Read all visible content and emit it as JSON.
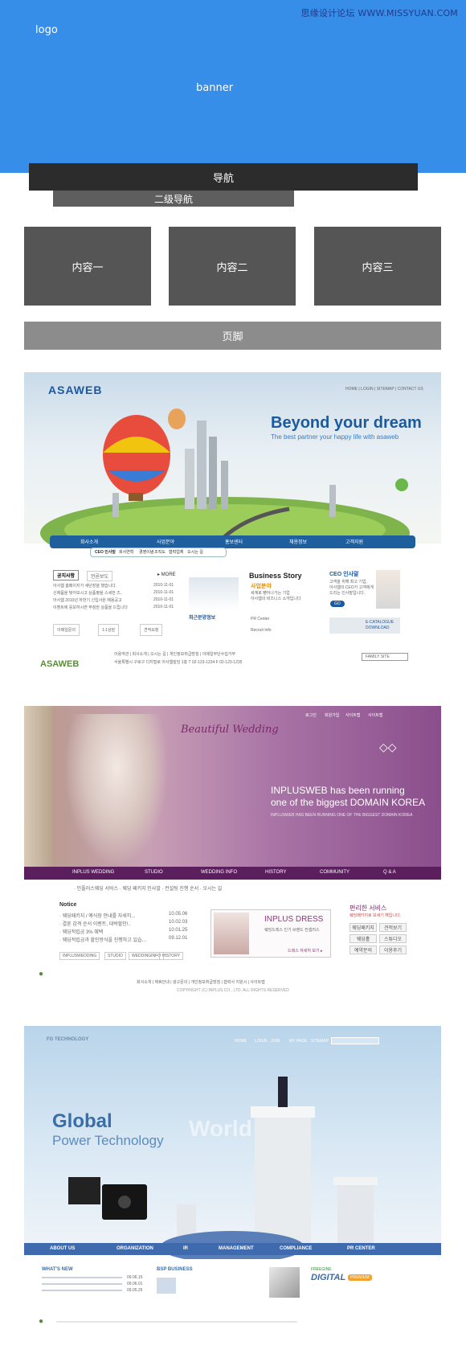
{
  "watermark": "思缘设计论坛 WWW.MISSYUAN.COM",
  "wireframe": {
    "logo": "logo",
    "banner": "banner",
    "nav": "导航",
    "subnav": "二级导航",
    "content": [
      "内容一",
      "内容二",
      "内容三"
    ],
    "footer": "页脚"
  },
  "example1": {
    "brand": "ASAWEB",
    "top_links": "HOME | LOGIN | SITEMAP | CONTACT US",
    "headline": "Beyond your dream",
    "subheadline": "The best partner your happy life with asaweb",
    "nav": [
      "회사소개",
      "사업분야",
      "홍보센터",
      "채용정보",
      "고객지원"
    ],
    "subnav": [
      "CEO 인사말",
      "회사연혁",
      "경영이념",
      "조직도",
      "협력업체",
      "오시는 길"
    ],
    "tabs": [
      "공지사항",
      "언론보도"
    ],
    "more": "▸ MORE",
    "notices": [
      {
        "text": "아사웹 홈페이지가 새단장을 했습니다.",
        "date": "2010-11-01"
      },
      {
        "text": "신제품을 빛어보시고 상품평을 스세한 즈..",
        "date": "2010-11-01"
      },
      {
        "text": "아사웹 2010년 하반기 신입사원 채용공고",
        "date": "2010-11-01"
      },
      {
        "text": "이벤트에 응모하시면 푸짐한 상품을 드립니다",
        "date": "2010-11-01"
      }
    ],
    "quick": [
      "이메일문의",
      "1:1상담",
      "견적요청"
    ],
    "business_title": "Business Story",
    "business_sub": "사업분야",
    "business_desc": "세계로 뻗어나가는 기업\n아사웹의 비즈니스 소개입니다",
    "recent": "최근분양정보",
    "pr_center": "PR Center",
    "recruit": "Recruit Info",
    "ceo_title": "CEO 인사말",
    "ceo_desc": "고객을 위해 최고 기업,\n아사웹의 CEO가 고객에게\n드리는 인사말입니다.",
    "go": "GO",
    "catalogue": "E-CATALOGUE DOWNLOAD",
    "footer_links": "이용약관 | 회사소개 | 오시는 길 | 개인정보취급방침 | 이메일무단수집거부",
    "footer_addr": "서울특별시 구로구 디지털로 아사웹빌딩 1층  T 02-123-1234  F 02-123-1235",
    "family": "FAMILY SITE"
  },
  "example2": {
    "script_title": "Beautiful  Wedding",
    "top_links": [
      "로그인",
      "회원가입",
      "사이트맵",
      "사이트맵"
    ],
    "headline1": "INPLUSWEB has been running",
    "headline2": "one of the biggest DOMAIN KOREA",
    "sub": "INPLUSWEB HAS BEEN RUNNING ONE OF THE BIGGEST DOMAIN KOREA",
    "nav": [
      "INPLUS WEDDING",
      "STUDIO",
      "WEDDING INFO",
      "HISTORY",
      "COMMUNITY",
      "Q & A"
    ],
    "subnav": "· 인플러스웨딩 서비스   · 웨딩 패키지 인사말   · 컨설팅 진행 순서   · 오시는 길",
    "notice_title": "Notice",
    "notices": [
      {
        "text": "· 웨딩패키지 / 예식장 안내를 자세히...",
        "date": "10.05.06"
      },
      {
        "text": "· 결혼 감격 순서 이벤트, 대박할인!..",
        "date": "10.02.03"
      },
      {
        "text": "· 웨딩적립금 3% 혜택",
        "date": "10.01.25"
      },
      {
        "text": "· 웨딩적립금과 할인방식을 진행하고 있습...",
        "date": "09.12.01"
      }
    ],
    "notice_tabs": [
      "INPLUSWEDDING",
      "STUDIO",
      "WEDDINGINFO",
      "HISTORY"
    ],
    "dress_title": "INPLUS DRESS",
    "dress_sub": "웨딩드레스 인기 브랜드 컨셉러스",
    "dress_more": "드레스 자세히 보기 ▸",
    "service_title": "편리한 서비스",
    "service_sub": "웨딩페키지로 보세기 해입니다.",
    "service_btns": [
      "웨딩패키지",
      "견적보기",
      "웨딩홀",
      "스튜디오",
      "예약문의",
      "이용후기"
    ],
    "footer_links": "회사소개  |  제휴안내  |  광고문의  |  개인정보취급방침  |  협력사 지원시  |  사이트맵",
    "copyright": "COPYRIGHT (C) INPLUS CO., LTD. ALL RIGHTS RESERVED"
  },
  "example3": {
    "brand": "FG TECHNOLOGY",
    "top_links": [
      "HOME",
      "LOGIN",
      "JOIN",
      "MY PAGE",
      "SITEMAP"
    ],
    "headline1": "Global",
    "headline2": "Power Technology",
    "world": "World",
    "nav": [
      "ABOUT US",
      "ORGANIZATION",
      "IR",
      "MANAGEMENT",
      "COMPLIANCE",
      "PR CENTER"
    ],
    "news_title": "WHAT'S NEW",
    "news_dates": [
      "09.06.15",
      "09.06.01",
      "09.05.25"
    ],
    "business_title": "BSP BUSINESS",
    "digital_title": "DIGITAL",
    "digital_badge": "PREMIUM",
    "freegine": "FREEGINE"
  },
  "colors": {
    "banner": "#368ee8",
    "nav": "#2c2c2c",
    "subnav": "#5e5e5e",
    "box": "#555555",
    "footer": "#8c8c8c"
  }
}
